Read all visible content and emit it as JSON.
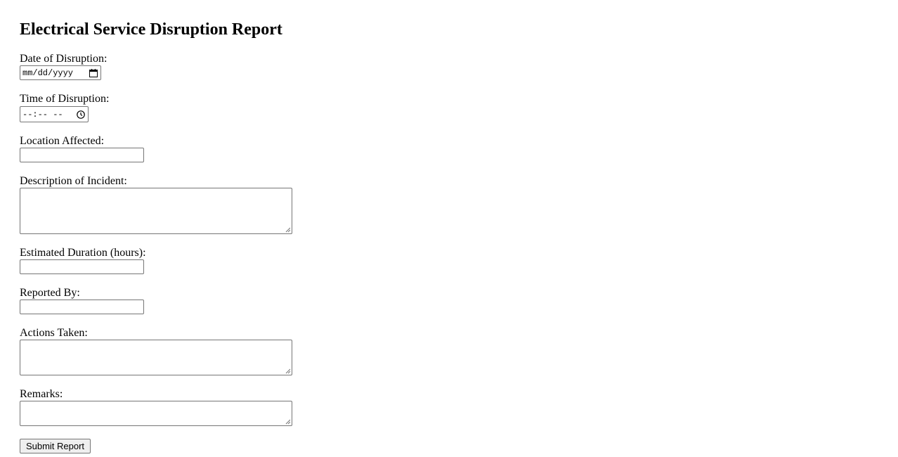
{
  "form": {
    "title": "Electrical Service Disruption Report",
    "date_label": "Date of Disruption:",
    "date_placeholder": "mm/dd/yyyy",
    "time_label": "Time of Disruption:",
    "time_placeholder": "--:-- --",
    "location_label": "Location Affected:",
    "location_value": "",
    "description_label": "Description of Incident:",
    "description_value": "",
    "duration_label": "Estimated Duration (hours):",
    "duration_value": "",
    "reported_by_label": "Reported By:",
    "reported_by_value": "",
    "actions_label": "Actions Taken:",
    "actions_value": "",
    "remarks_label": "Remarks:",
    "remarks_value": "",
    "submit_label": "Submit Report"
  },
  "icons": {
    "date_picker": "calendar-icon",
    "time_picker": "clock-icon",
    "resize_handle": "resize-grip-icon"
  },
  "colors": {
    "border": "#767676",
    "button_bg": "#efefef",
    "text": "#000000",
    "background": "#ffffff"
  }
}
